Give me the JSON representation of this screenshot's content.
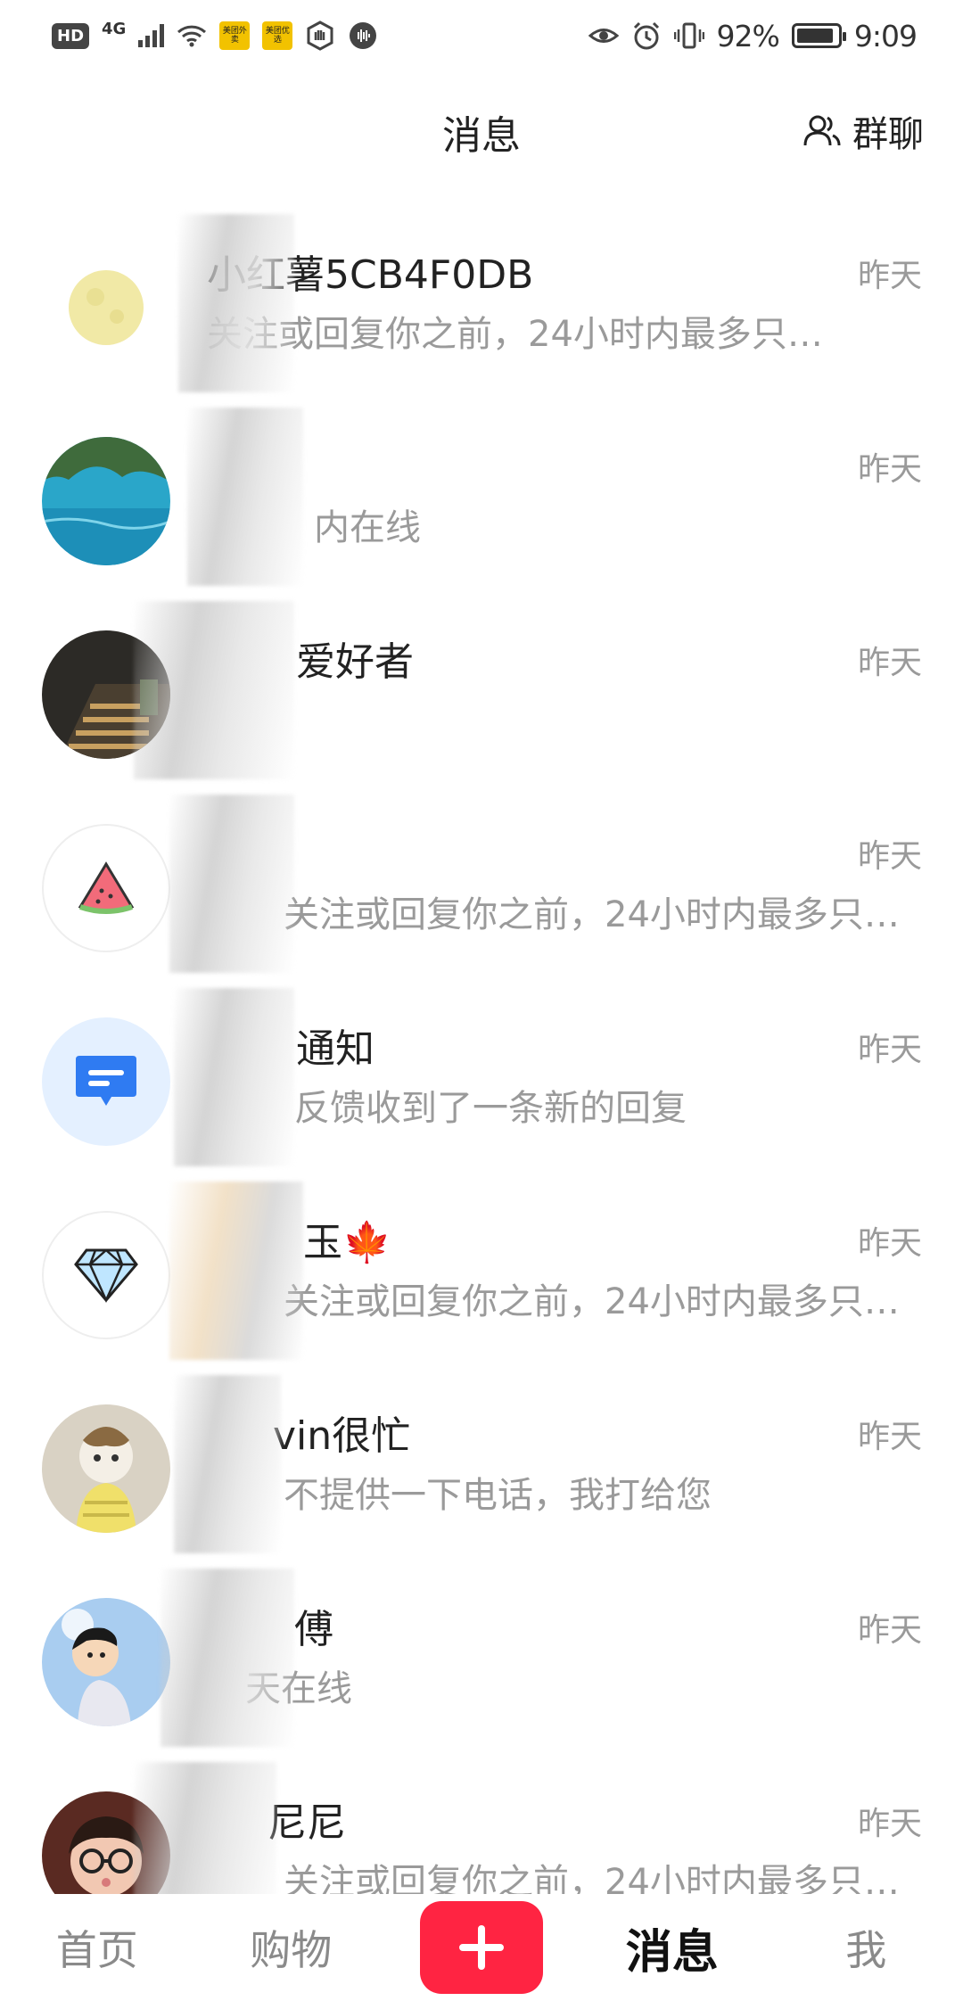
{
  "status_bar": {
    "hd": "HD",
    "network": "4G",
    "app_icon_1": "美团外卖",
    "app_icon_2": "美团优选",
    "battery": "92%",
    "time": "9:09"
  },
  "header": {
    "title": "消息",
    "group_chat_label": "群聊"
  },
  "messages": [
    {
      "name": "小红薯5CB4F0DB",
      "preview": "关注或回复你之前，24小时内最多只…",
      "time": "昨天"
    },
    {
      "name": "",
      "preview": "内在线",
      "time": "昨天"
    },
    {
      "name": "爱好者",
      "preview": "",
      "time": "昨天"
    },
    {
      "name": "",
      "preview": "关注或回复你之前，24小时内最多只…",
      "time": "昨天"
    },
    {
      "name": "通知",
      "preview": "反馈收到了一条新的回复",
      "time": "昨天"
    },
    {
      "name": "玉🍁",
      "preview": "关注或回复你之前，24小时内最多只…",
      "time": "昨天"
    },
    {
      "name": "vin很忙",
      "preview": "不提供一下电话，我打给您",
      "time": "昨天"
    },
    {
      "name": "傅",
      "preview": "天在线",
      "time": "昨天"
    },
    {
      "name": "尼尼",
      "preview": "关注或回复你之前，24小时内最多只…",
      "time": "昨天"
    }
  ],
  "bottom_nav": {
    "home": "首页",
    "shop": "购物",
    "messages": "消息",
    "me": "我"
  },
  "colors": {
    "accent": "#ff2442",
    "secondary_text": "#9a9a9a"
  }
}
